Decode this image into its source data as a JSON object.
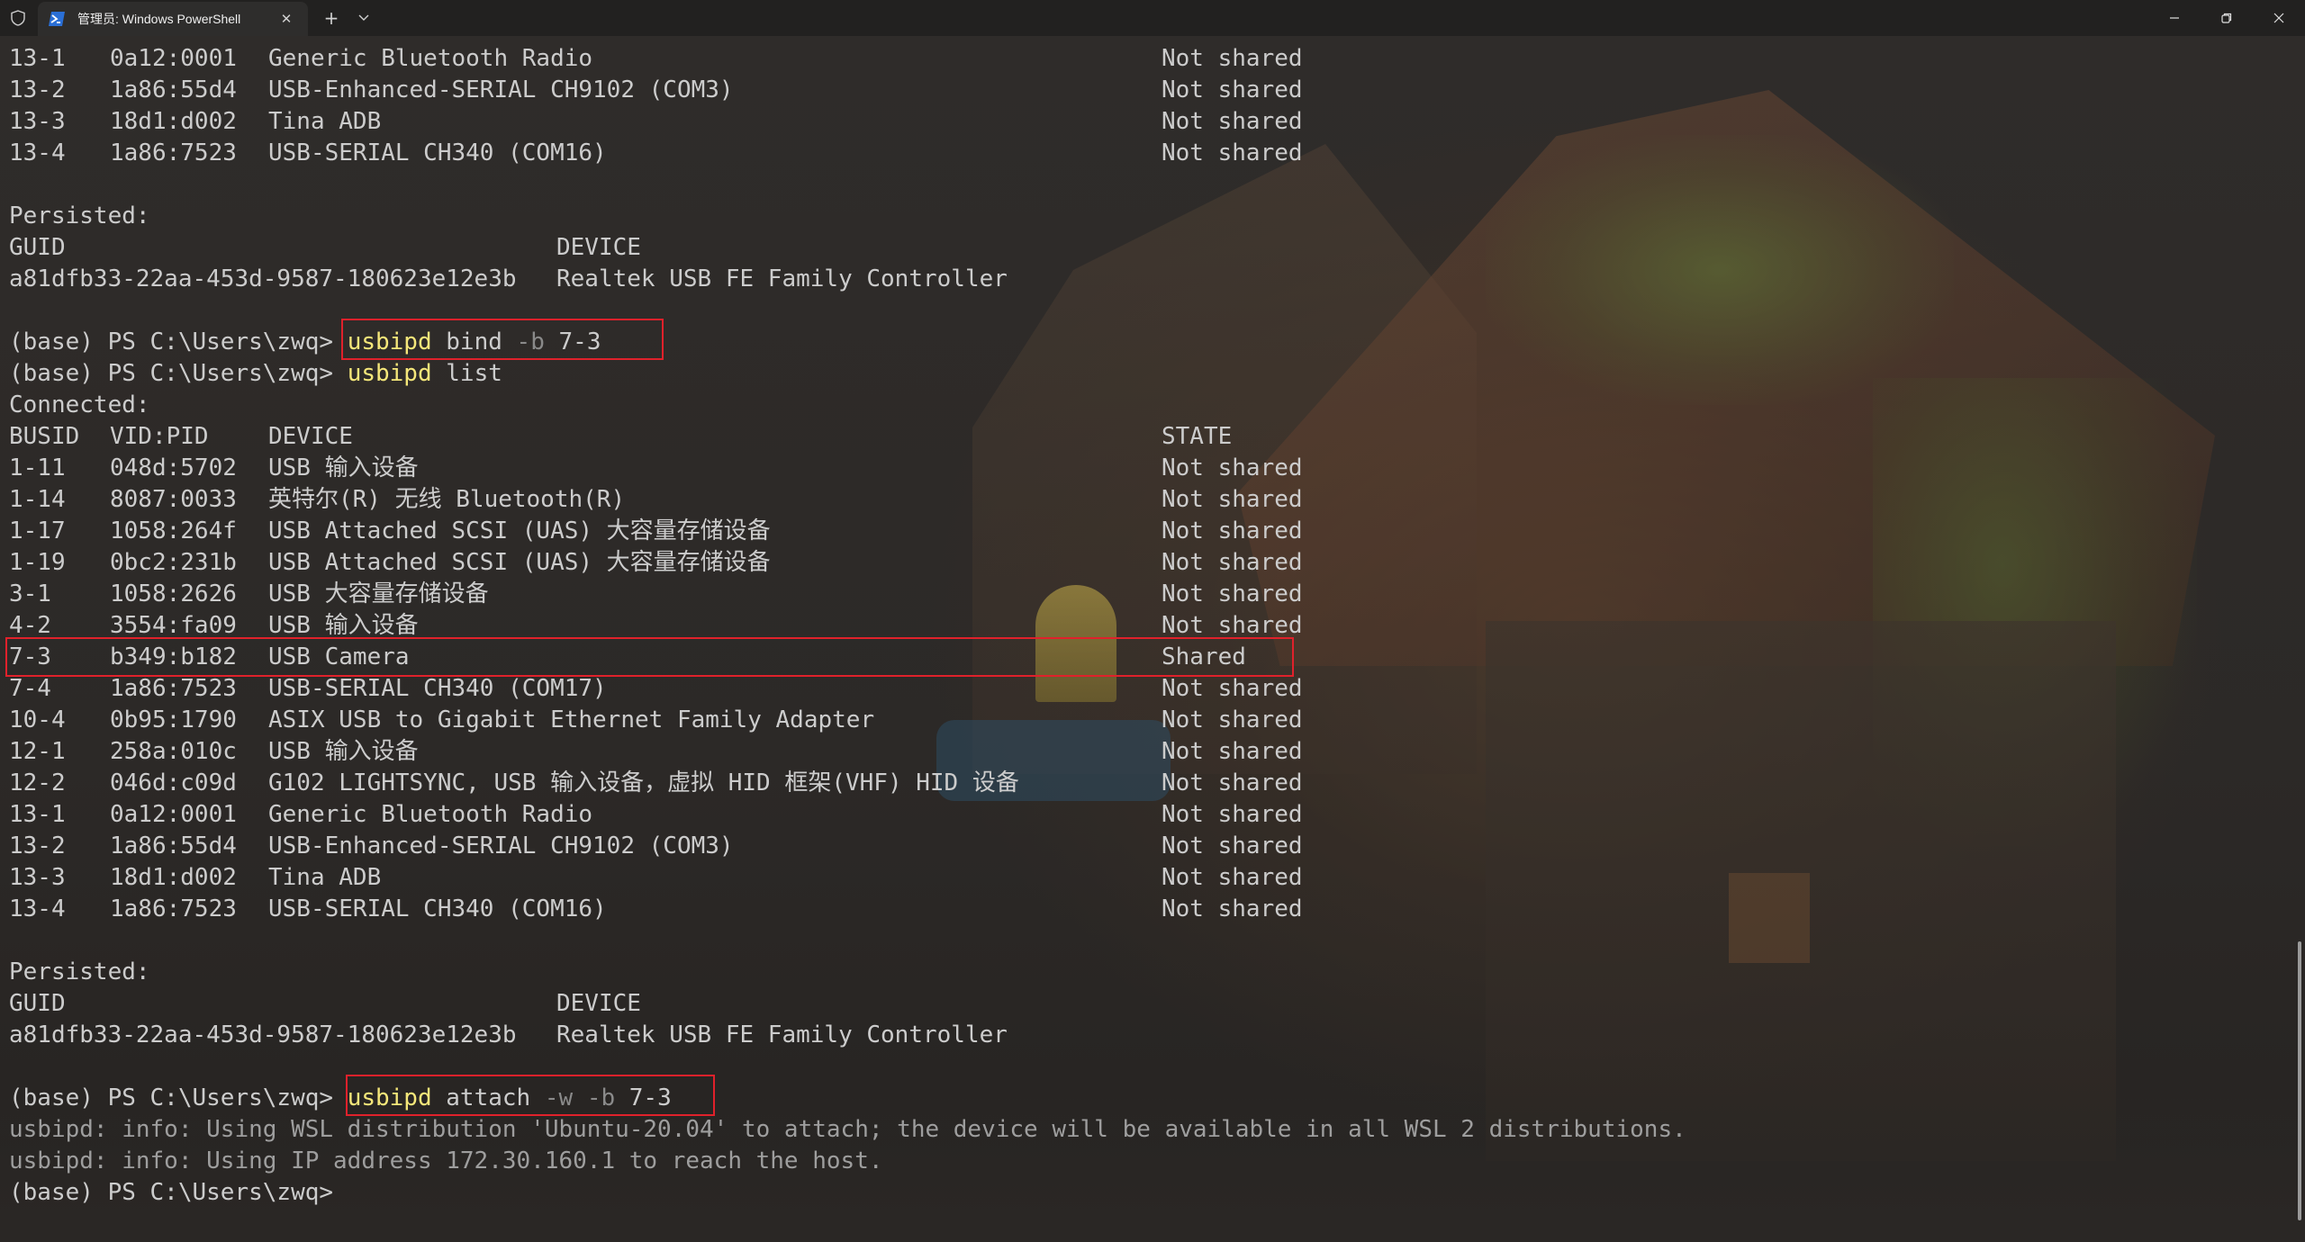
{
  "titlebar": {
    "tab_title": "管理员: Windows PowerShell",
    "icons": {
      "shield": "shield-icon",
      "powershell": "powershell-icon",
      "close_tab": "close-icon",
      "new_tab": "plus-icon",
      "dropdown": "chevron-down-icon",
      "minimize": "minimize-icon",
      "maximize": "restore-icon",
      "close_window": "close-icon"
    },
    "new_tab_glyph": "+",
    "dropdown_glyph": "⌄",
    "close_glyph": "✕"
  },
  "colors": {
    "command": "#f5e77a",
    "parameter": "#8a8a8a",
    "text": "#cccccc",
    "highlight_box": "#e0212b",
    "title_bar": "#222120"
  },
  "terminal": {
    "top_devices": [
      {
        "busid": "13-1",
        "vidpid": "0a12:0001",
        "device": "Generic Bluetooth Radio",
        "state": "Not shared"
      },
      {
        "busid": "13-2",
        "vidpid": "1a86:55d4",
        "device": "USB-Enhanced-SERIAL CH9102 (COM3)",
        "state": "Not shared"
      },
      {
        "busid": "13-3",
        "vidpid": "18d1:d002",
        "device": "Tina ADB",
        "state": "Not shared"
      },
      {
        "busid": "13-4",
        "vidpid": "1a86:7523",
        "device": "USB-SERIAL CH340 (COM16)",
        "state": "Not shared"
      }
    ],
    "persisted_1": {
      "label": "Persisted:",
      "guid_header": "GUID",
      "device_header": "DEVICE",
      "guid": "a81dfb33-22aa-453d-9587-180623e12e3b",
      "device": "Realtek USB FE Family Controller"
    },
    "prompt": "(base) PS C:\\Users\\zwq>",
    "cmd_bind": {
      "program": "usbipd",
      "verb": "bind",
      "flag": "-b",
      "arg": "7-3"
    },
    "cmd_list": {
      "program": "usbipd",
      "verb": "list"
    },
    "connected_label": "Connected:",
    "headers": {
      "busid": "BUSID",
      "vidpid": "VID:PID",
      "device": "DEVICE",
      "state": "STATE"
    },
    "devices": [
      {
        "busid": "1-11",
        "vidpid": "048d:5702",
        "device": "USB 输入设备",
        "state": "Not shared"
      },
      {
        "busid": "1-14",
        "vidpid": "8087:0033",
        "device": "英特尔(R) 无线 Bluetooth(R)",
        "state": "Not shared"
      },
      {
        "busid": "1-17",
        "vidpid": "1058:264f",
        "device": "USB Attached SCSI (UAS) 大容量存储设备",
        "state": "Not shared"
      },
      {
        "busid": "1-19",
        "vidpid": "0bc2:231b",
        "device": "USB Attached SCSI (UAS) 大容量存储设备",
        "state": "Not shared"
      },
      {
        "busid": "3-1",
        "vidpid": "1058:2626",
        "device": "USB 大容量存储设备",
        "state": "Not shared"
      },
      {
        "busid": "4-2",
        "vidpid": "3554:fa09",
        "device": "USB 输入设备",
        "state": "Not shared"
      },
      {
        "busid": "7-3",
        "vidpid": "b349:b182",
        "device": "USB Camera",
        "state": "Shared"
      },
      {
        "busid": "7-4",
        "vidpid": "1a86:7523",
        "device": "USB-SERIAL CH340 (COM17)",
        "state": "Not shared"
      },
      {
        "busid": "10-4",
        "vidpid": "0b95:1790",
        "device": "ASIX USB to Gigabit Ethernet Family Adapter",
        "state": "Not shared"
      },
      {
        "busid": "12-1",
        "vidpid": "258a:010c",
        "device": "USB 输入设备",
        "state": "Not shared"
      },
      {
        "busid": "12-2",
        "vidpid": "046d:c09d",
        "device": "G102 LIGHTSYNC, USB 输入设备，虚拟 HID 框架(VHF) HID 设备",
        "state": "Not shared"
      },
      {
        "busid": "13-1",
        "vidpid": "0a12:0001",
        "device": "Generic Bluetooth Radio",
        "state": "Not shared"
      },
      {
        "busid": "13-2",
        "vidpid": "1a86:55d4",
        "device": "USB-Enhanced-SERIAL CH9102 (COM3)",
        "state": "Not shared"
      },
      {
        "busid": "13-3",
        "vidpid": "18d1:d002",
        "device": "Tina ADB",
        "state": "Not shared"
      },
      {
        "busid": "13-4",
        "vidpid": "1a86:7523",
        "device": "USB-SERIAL CH340 (COM16)",
        "state": "Not shared"
      }
    ],
    "persisted_2": {
      "label": "Persisted:",
      "guid_header": "GUID",
      "device_header": "DEVICE",
      "guid": "a81dfb33-22aa-453d-9587-180623e12e3b",
      "device": "Realtek USB FE Family Controller"
    },
    "cmd_attach": {
      "program": "usbipd",
      "verb": "attach",
      "flag1": "-w",
      "flag2": "-b",
      "arg": "7-3"
    },
    "info_lines": [
      "usbipd: info: Using WSL distribution 'Ubuntu-20.04' to attach; the device will be available in all WSL 2 distributions.",
      "usbipd: info: Using IP address 172.30.160.1 to reach the host."
    ],
    "final_prompt": "(base) PS C:\\Users\\zwq>"
  }
}
